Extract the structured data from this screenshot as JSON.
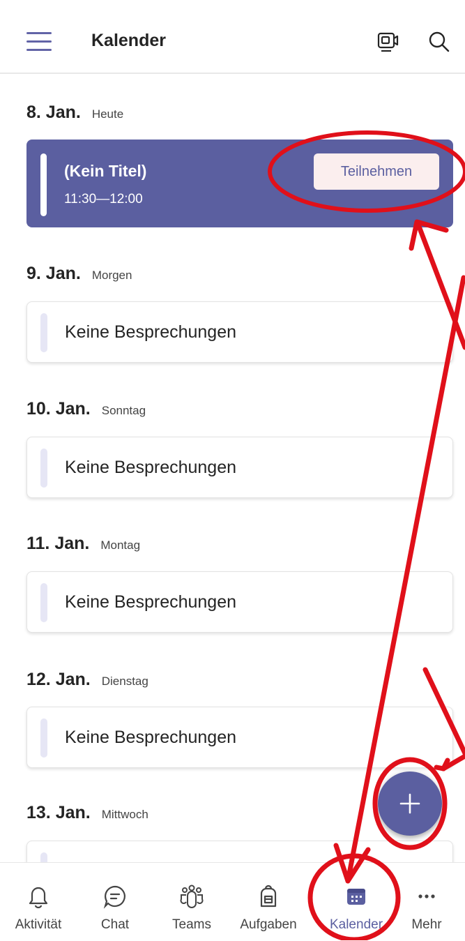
{
  "header": {
    "title": "Kalender",
    "icons": [
      "hamburger-menu-icon",
      "meet-now-icon",
      "search-icon"
    ]
  },
  "days": [
    {
      "date": "8. Jan.",
      "relative": "Heute"
    },
    {
      "date": "9. Jan.",
      "relative": "Morgen",
      "empty_text": "Keine Besprechungen"
    },
    {
      "date": "10. Jan.",
      "relative": "Sonntag",
      "empty_text": "Keine Besprechungen"
    },
    {
      "date": "11. Jan.",
      "relative": "Montag",
      "empty_text": "Keine Besprechungen"
    },
    {
      "date": "12. Jan.",
      "relative": "Dienstag",
      "empty_text": "Keine Besprechungen"
    },
    {
      "date": "13. Jan.",
      "relative": "Mittwoch"
    }
  ],
  "event": {
    "title": "(Kein Titel)",
    "time": "11:30—12:00",
    "join_label": "Teilnehmen"
  },
  "fab": {
    "icon": "plus-icon"
  },
  "bottom_nav": [
    {
      "label": "Aktivität",
      "icon": "bell-icon"
    },
    {
      "label": "Chat",
      "icon": "chat-icon"
    },
    {
      "label": "Teams",
      "icon": "teams-icon"
    },
    {
      "label": "Aufgaben",
      "icon": "tasks-icon"
    },
    {
      "label": "Kalender",
      "icon": "calendar-icon",
      "active": true
    },
    {
      "label": "Mehr",
      "icon": "more-icon"
    }
  ],
  "colors": {
    "accent": "#5b5fa0",
    "annotation": "#e0101a",
    "join_button_bg": "#fbeeee"
  }
}
